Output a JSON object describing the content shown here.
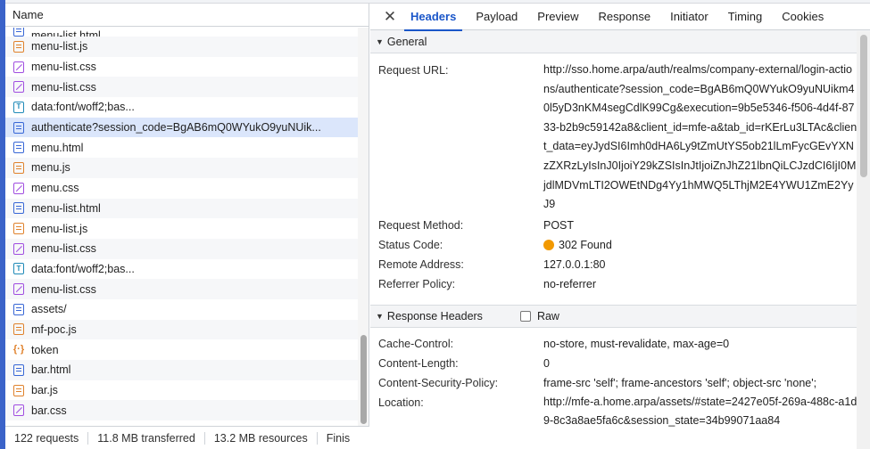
{
  "list": {
    "header": "Name",
    "rows": [
      {
        "name": "menu-list.html",
        "type": "doc",
        "partial": true
      },
      {
        "name": "menu-list.js",
        "type": "js"
      },
      {
        "name": "menu-list.css",
        "type": "css"
      },
      {
        "name": "menu-list.css",
        "type": "css"
      },
      {
        "name": "data:font/woff2;bas...",
        "type": "font"
      },
      {
        "name": "authenticate?session_code=BgAB6mQ0WYukO9yuNUik...",
        "type": "doc",
        "selected": true
      },
      {
        "name": "menu.html",
        "type": "doc"
      },
      {
        "name": "menu.js",
        "type": "js"
      },
      {
        "name": "menu.css",
        "type": "css"
      },
      {
        "name": "menu-list.html",
        "type": "doc"
      },
      {
        "name": "menu-list.js",
        "type": "js"
      },
      {
        "name": "menu-list.css",
        "type": "css"
      },
      {
        "name": "data:font/woff2;bas...",
        "type": "font"
      },
      {
        "name": "menu-list.css",
        "type": "css"
      },
      {
        "name": "assets/",
        "type": "doc"
      },
      {
        "name": "mf-poc.js",
        "type": "js"
      },
      {
        "name": "token",
        "type": "fetch"
      },
      {
        "name": "bar.html",
        "type": "doc"
      },
      {
        "name": "bar.js",
        "type": "js"
      },
      {
        "name": "bar.css",
        "type": "css"
      }
    ]
  },
  "footer": {
    "requests": "122 requests",
    "transferred": "11.8 MB transferred",
    "resources": "13.2 MB resources",
    "finish": "Finis"
  },
  "tabs": {
    "close": "✕",
    "items": [
      "Headers",
      "Payload",
      "Preview",
      "Response",
      "Initiator",
      "Timing",
      "Cookies"
    ]
  },
  "general": {
    "title": "General",
    "request_url_label": "Request URL:",
    "request_url": "http://sso.home.arpa/auth/realms/company-external/login-actions/authenticate?session_code=BgAB6mQ0WYukO9yuNUikm40l5yD3nKM4segCdlK99Cg&execution=9b5e5346-f506-4d4f-8733-b2b9c59142a8&client_id=mfe-a&tab_id=rKErLu3LTAc&client_data=eyJydSI6Imh0dHA6Ly9tZmUtYS5ob21lLmFycGEvYXNzZXRzLyIsInJ0IjoiY29kZSIsInJtIjoiZnJhZ21lbnQiLCJzdCI6IjI0MjdlMDVmLTI2OWEtNDg4Yy1hMWQ5LThjM2E4YWU1ZmE2YyJ9",
    "method_label": "Request Method:",
    "method": "POST",
    "status_label": "Status Code:",
    "status": "302 Found",
    "status_color": "#f29900",
    "remote_label": "Remote Address:",
    "remote": "127.0.0.1:80",
    "referrer_label": "Referrer Policy:",
    "referrer": "no-referrer"
  },
  "response_headers": {
    "title": "Response Headers",
    "raw_label": "Raw",
    "cache_label": "Cache-Control:",
    "cache": "no-store, must-revalidate, max-age=0",
    "length_label": "Content-Length:",
    "length": "0",
    "csp_label": "Content-Security-Policy:",
    "csp": "frame-src 'self'; frame-ancestors 'self'; object-src 'none';",
    "location_label": "Location:",
    "location": "http://mfe-a.home.arpa/assets/#state=2427e05f-269a-488c-a1d9-8c3a8ae5fa6c&session_state=34b99071aa84"
  }
}
